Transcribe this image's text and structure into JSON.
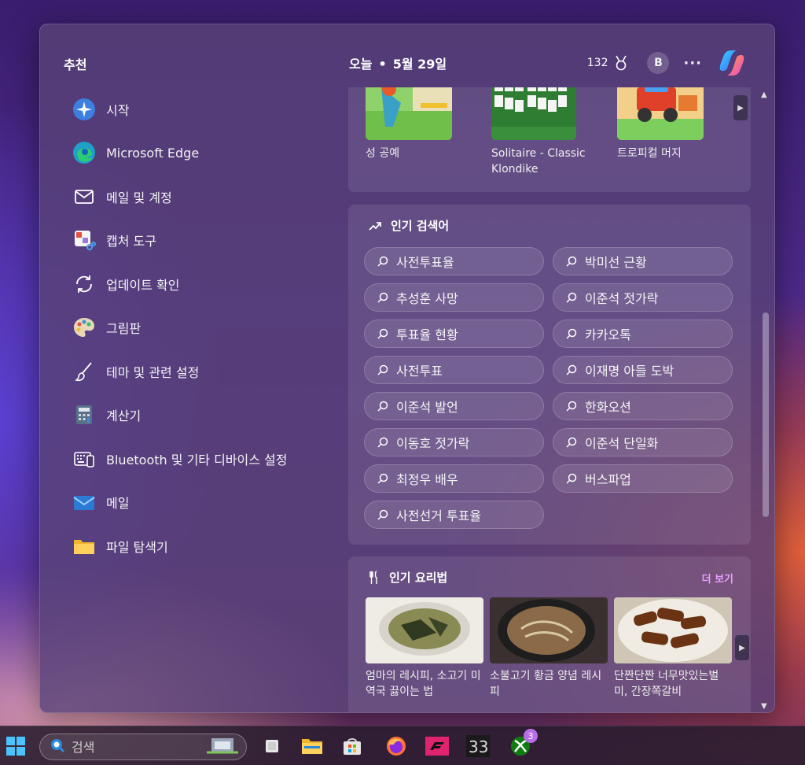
{
  "recommended": {
    "title": "추천",
    "apps": [
      {
        "label": "시작",
        "icon": "get-started-icon"
      },
      {
        "label": "Microsoft Edge",
        "icon": "edge-icon"
      },
      {
        "label": "메일 및 계정",
        "icon": "mail-account-icon"
      },
      {
        "label": "캡처 도구",
        "icon": "snipping-tool-icon"
      },
      {
        "label": "업데이트 확인",
        "icon": "update-icon"
      },
      {
        "label": "그림판",
        "icon": "paint-icon"
      },
      {
        "label": "테마 및 관련 설정",
        "icon": "brush-icon"
      },
      {
        "label": "계산기",
        "icon": "calculator-icon"
      },
      {
        "label": "Bluetooth 및 기타 디바이스 설정",
        "icon": "devices-icon"
      },
      {
        "label": "메일",
        "icon": "mail-icon"
      },
      {
        "label": "파일 탐색기",
        "icon": "folder-icon"
      }
    ]
  },
  "header": {
    "date_prefix": "오늘",
    "date": "5월 29일",
    "points": "132",
    "avatar": "B",
    "more": "···"
  },
  "games": [
    {
      "label": "성 공예",
      "icon": "castle-game-icon"
    },
    {
      "label": "Solitaire - Classic Klondike",
      "icon": "solitaire-icon"
    },
    {
      "label": "트로피컬 머지",
      "icon": "tropical-merge-icon"
    }
  ],
  "trending": {
    "title": "인기 검색어",
    "items": [
      "사전투표율",
      "박미선 근황",
      "추성훈 사망",
      "이준석 젓가락",
      "투표율 현황",
      "카카오톡",
      "사전투표",
      "이재명 아들 도박",
      "이준석 발언",
      "한화오션",
      "이동호 젓가락",
      "이준석 단일화",
      "최정우 배우",
      "버스파업",
      "사전선거 투표율"
    ]
  },
  "recipes": {
    "title": "인기 요리법",
    "more": "더 보기",
    "items": [
      {
        "label": "엄마의 레시피, 소고기 미역국 끓이는 법"
      },
      {
        "label": "소불고기 황금 양념 레시피"
      },
      {
        "label": "단짠단짠 너무맛있는벌미, 간장쪽갈비"
      }
    ]
  },
  "taskbar": {
    "search_placeholder": "검색",
    "xbox_badge": "3",
    "apps": [
      "start-icon",
      "task-view-icon",
      "file-explorer-icon",
      "store-icon",
      "firefox-icon",
      "forza-icon",
      "app-33-icon",
      "xbox-icon"
    ]
  }
}
